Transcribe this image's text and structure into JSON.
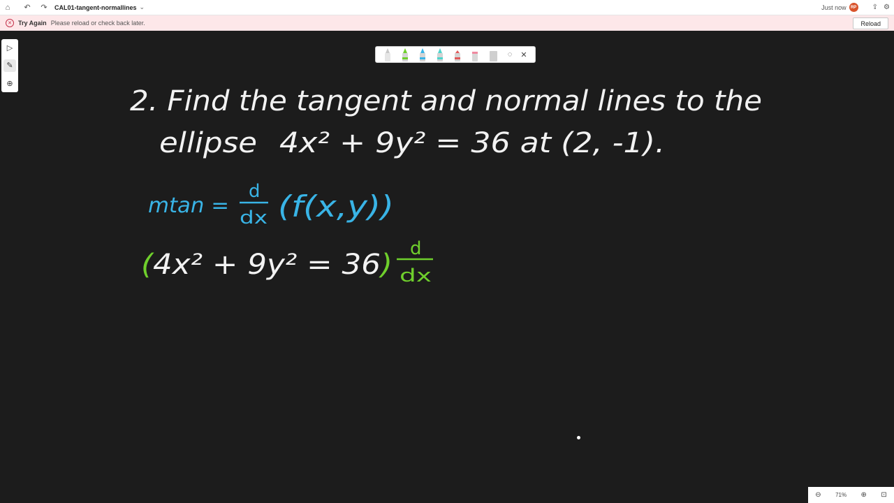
{
  "titlebar": {
    "doc_title": "CAL01-tangent-normallines",
    "status": "Just now",
    "avatar_initials": "RP"
  },
  "notice": {
    "title": "Try Again",
    "message": "Please reload or check back later.",
    "reload_label": "Reload"
  },
  "canvas": {
    "problem_line1": "2. Find the tangent and normal lines to the",
    "problem_line2_word": "ellipse",
    "problem_line2_eq": "4x² + 9y² = 36 at (2, -1).",
    "mtan_label": "mtan =",
    "mtan_frac_num": "d",
    "mtan_frac_den": "dx",
    "mtan_expr": "(f(x,y))",
    "eq2_expr": "(4x² + 9y² = 36)",
    "eq2_frac_num": "d",
    "eq2_frac_den": "dx",
    "colors": {
      "white_ink": "#f2f2f2",
      "blue_ink": "#39b4e6",
      "green_ink": "#6fcf2c",
      "background": "#1c1c1c"
    }
  },
  "zoom": {
    "level": "71%"
  },
  "icons": [
    "home-icon",
    "undo-icon",
    "redo-icon",
    "chevron-down-icon",
    "share-icon",
    "settings-icon",
    "error-icon",
    "select-icon",
    "pen-icon",
    "add-icon",
    "lasso-icon",
    "close-icon",
    "zoom-out-icon",
    "zoom-in-icon",
    "fit-icon"
  ]
}
